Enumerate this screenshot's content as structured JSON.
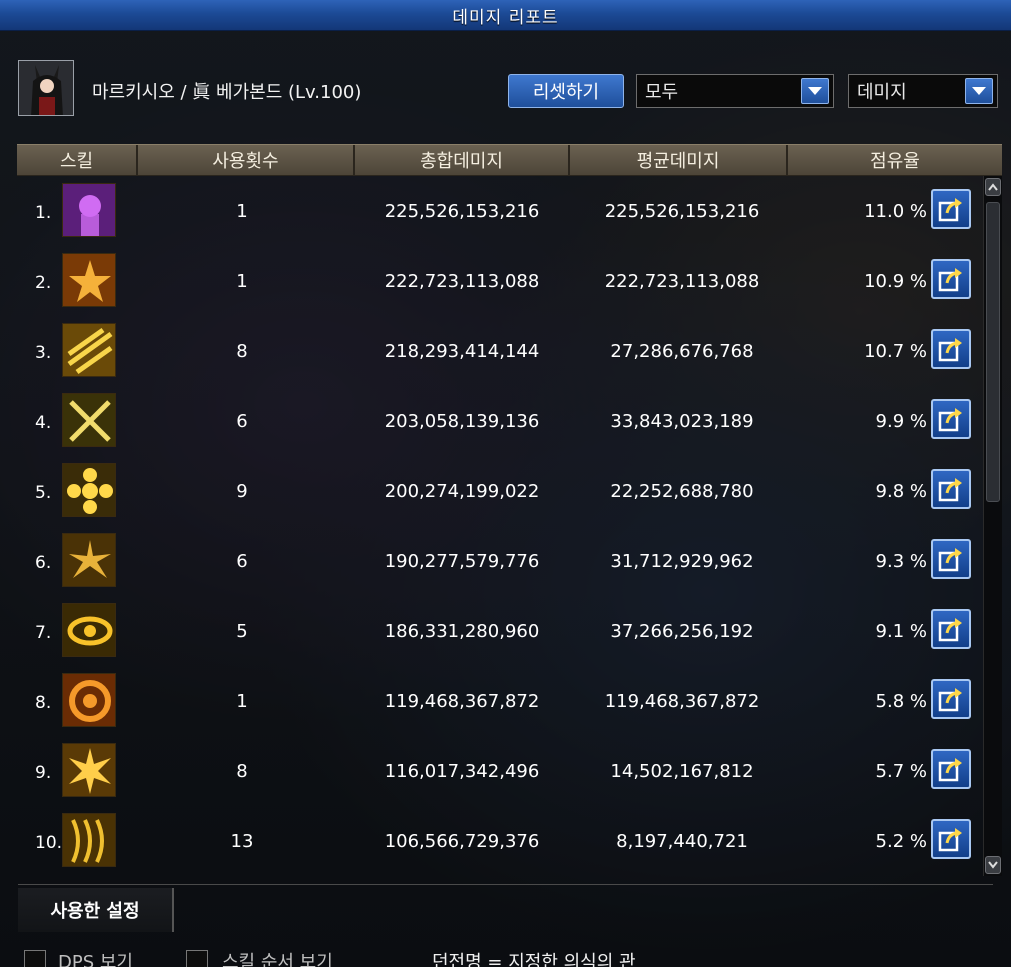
{
  "window": {
    "title": "데미지 리포트"
  },
  "header": {
    "character": "마르키시오 / 眞 베가본드 (Lv.100)",
    "reset_label": "리셋하기",
    "filter_value": "모두",
    "type_value": "데미지"
  },
  "table": {
    "columns": [
      "스킬",
      "사용횟수",
      "총합데미지",
      "평균데미지",
      "점유율"
    ],
    "rows": [
      {
        "rank": "1.",
        "uses": "1",
        "total": "225,526,153,216",
        "avg": "225,526,153,216",
        "share": "11.0 %",
        "icon": "skill-icon-purple-portrait",
        "c1": "#5b1f7a",
        "c2": "#d06cf2"
      },
      {
        "rank": "2.",
        "uses": "1",
        "total": "222,723,113,088",
        "avg": "222,723,113,088",
        "share": "10.9 %",
        "icon": "skill-icon-orange-burst",
        "c1": "#7a3a06",
        "c2": "#f5b13a"
      },
      {
        "rank": "3.",
        "uses": "8",
        "total": "218,293,414,144",
        "avg": "27,286,676,768",
        "share": "10.7 %",
        "icon": "skill-icon-gold-slash",
        "c1": "#6a4a08",
        "c2": "#f8d54a"
      },
      {
        "rank": "4.",
        "uses": "6",
        "total": "203,058,139,136",
        "avg": "33,843,023,189",
        "share": "9.9 %",
        "icon": "skill-icon-cross-blades",
        "c1": "#3a3208",
        "c2": "#f1dc6c"
      },
      {
        "rank": "5.",
        "uses": "9",
        "total": "200,274,199,022",
        "avg": "22,252,688,780",
        "share": "9.8 %",
        "icon": "skill-icon-gold-flower",
        "c1": "#3a2c08",
        "c2": "#ffd84a"
      },
      {
        "rank": "6.",
        "uses": "6",
        "total": "190,277,579,776",
        "avg": "31,712,929,962",
        "share": "9.3 %",
        "icon": "skill-icon-gold-sparks",
        "c1": "#4a3206",
        "c2": "#e8b23a"
      },
      {
        "rank": "7.",
        "uses": "5",
        "total": "186,331,280,960",
        "avg": "37,266,256,192",
        "share": "9.1 %",
        "icon": "skill-icon-gold-swirl",
        "c1": "#3a2a04",
        "c2": "#f8c22a"
      },
      {
        "rank": "8.",
        "uses": "1",
        "total": "119,468,367,872",
        "avg": "119,468,367,872",
        "share": "5.8 %",
        "icon": "skill-icon-orange-vortex",
        "c1": "#6a2c04",
        "c2": "#f59a2a"
      },
      {
        "rank": "9.",
        "uses": "8",
        "total": "116,017,342,496",
        "avg": "14,502,167,812",
        "share": "5.7 %",
        "icon": "skill-icon-gold-explosion",
        "c1": "#5a3a06",
        "c2": "#ffce4a"
      },
      {
        "rank": "10.",
        "uses": "13",
        "total": "106,566,729,376",
        "avg": "8,197,440,721",
        "share": "5.2 %",
        "icon": "skill-icon-gold-claw",
        "c1": "#4a3204",
        "c2": "#f0c030"
      }
    ]
  },
  "tabs": {
    "used_settings": "사용한 설정"
  },
  "footer": {
    "dps_label": "DPS 보기",
    "skill_order_label": "스킬 순서 보기",
    "dungeon": "던전명 = 지정한 의식의 관"
  }
}
